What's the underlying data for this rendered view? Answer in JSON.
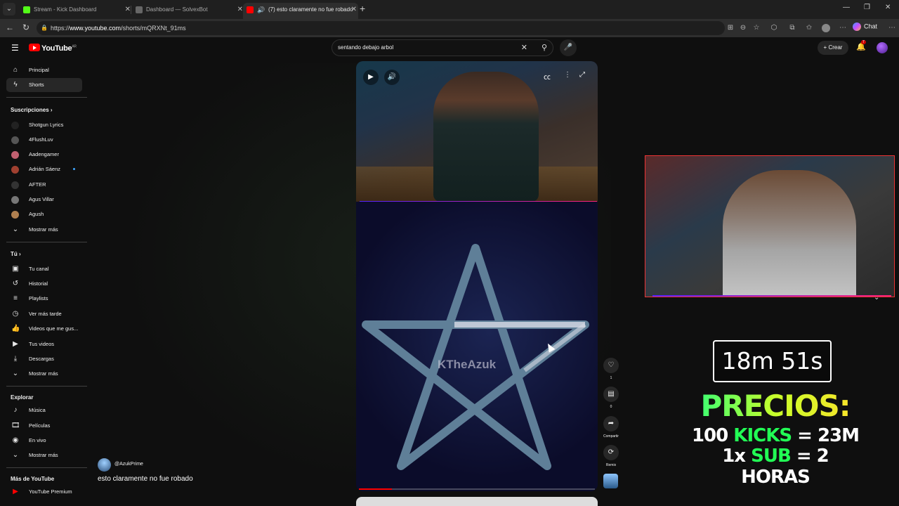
{
  "browser": {
    "tabs": [
      {
        "title": "Stream - Kick Dashboard",
        "color": "#53fc18"
      },
      {
        "title": "Dashboard — SolvexBot",
        "color": "#666666"
      },
      {
        "title": "(7) esto claramente no fue robado",
        "color": "#ff0000"
      }
    ],
    "url_prefix": "https://",
    "url_domain": "www.youtube.com",
    "url_path": "/shorts/mQRXNt_91ms",
    "chat_label": "Chat"
  },
  "youtube": {
    "logo_text": "YouTube",
    "logo_region": "AR",
    "search_value": "sentando debajo arbol",
    "create_label": "Crear",
    "notif_count": "7"
  },
  "sidebar": {
    "main": [
      {
        "label": "Principal",
        "icon": "home-icon"
      },
      {
        "label": "Shorts",
        "icon": "shorts-icon"
      }
    ],
    "subs_header": "Suscripciones",
    "subs": [
      {
        "label": "Shotgun Lyrics",
        "color": "#222222"
      },
      {
        "label": "4FlushLuv",
        "color": "#555555"
      },
      {
        "label": "Aadengamer",
        "color": "#c06070"
      },
      {
        "label": "Adrián Sáenz",
        "color": "#a04030"
      },
      {
        "label": "AFTER",
        "color": "#333333"
      },
      {
        "label": "Agus Villar",
        "color": "#777777"
      },
      {
        "label": "Agush",
        "color": "#b08050"
      }
    ],
    "subs_more": "Mostrar más",
    "you_header": "Tú",
    "you": [
      {
        "label": "Tu canal"
      },
      {
        "label": "Historial"
      },
      {
        "label": "Playlists"
      },
      {
        "label": "Ver más tarde"
      },
      {
        "label": "Videos que me gus..."
      },
      {
        "label": "Tus videos"
      },
      {
        "label": "Descargas"
      }
    ],
    "you_more": "Mostrar más",
    "explore_header": "Explorar",
    "explore": [
      {
        "label": "Música"
      },
      {
        "label": "Películas"
      },
      {
        "label": "En vivo"
      }
    ],
    "explore_more": "Mostrar más",
    "more_header": "Más de YouTube",
    "premium": "YouTube Premium"
  },
  "short": {
    "channel": "@AzukPrime",
    "title": "esto claramente no fue robado",
    "watermark": "TheAzuk",
    "progress_fraction": 0.14,
    "likes": "1",
    "comments": "0",
    "share_label": "Compartir",
    "remix_label": "Remix"
  },
  "overlay": {
    "timer": "18m 51s",
    "headline": "PRECIOS:",
    "line1_pre": "100 ",
    "line1_hl": "KICKS",
    "line1_post": " = 23M",
    "line2_pre": "1x ",
    "line2_hl": "SUB",
    "line2_post": " = 2 HORAS"
  }
}
